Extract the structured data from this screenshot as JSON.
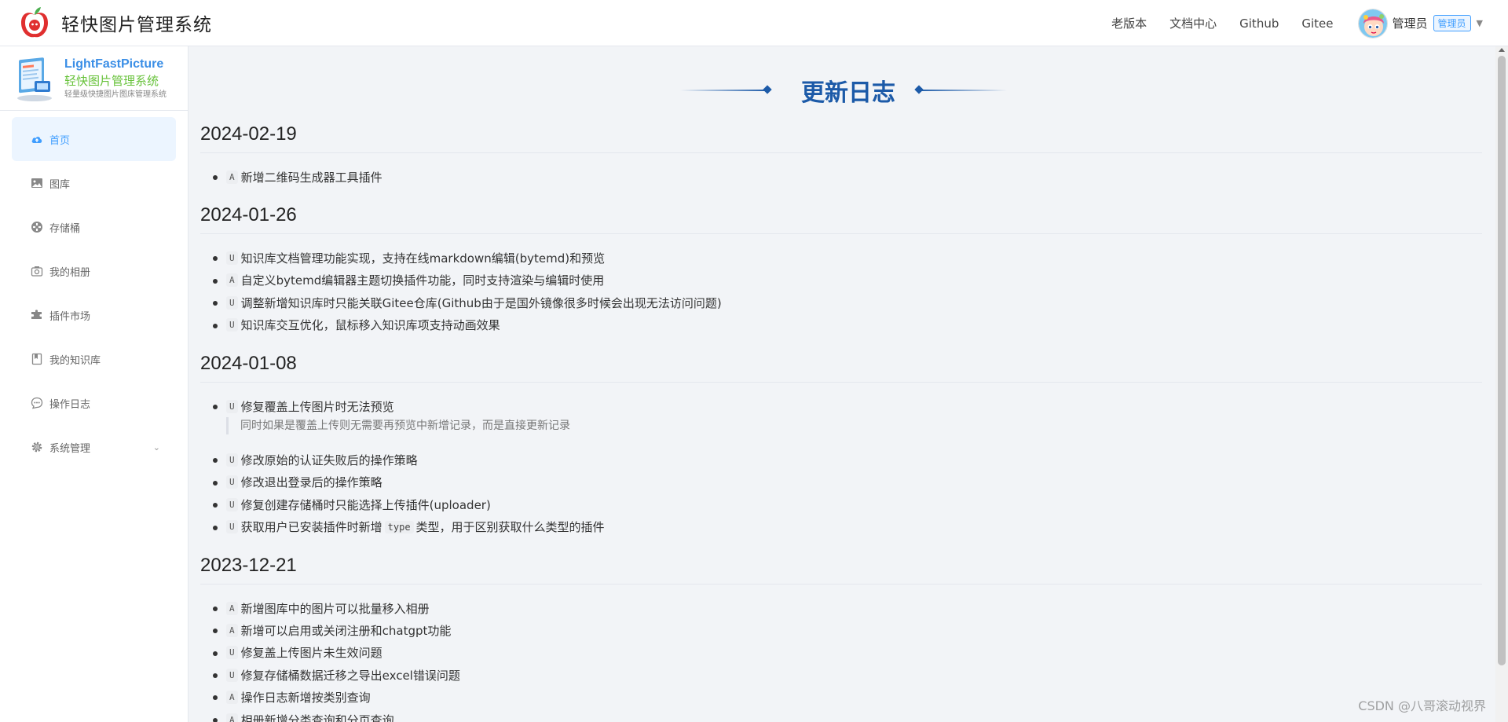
{
  "header": {
    "app_title": "轻快图片管理系统",
    "nav": [
      "老版本",
      "文档中心",
      "Github",
      "Gitee"
    ],
    "user": {
      "name": "管理员",
      "role_badge": "管理员"
    }
  },
  "sidebar": {
    "brand": {
      "name_en": "LightFastPicture",
      "name_cn": "轻快图片管理系统",
      "tagline": "轻量级快捷图片图床管理系统"
    },
    "items": [
      {
        "label": "首页",
        "icon": "cloud-upload-icon",
        "active": true
      },
      {
        "label": "图库",
        "icon": "image-icon",
        "active": false
      },
      {
        "label": "存储桶",
        "icon": "bucket-icon",
        "active": false
      },
      {
        "label": "我的相册",
        "icon": "camera-icon",
        "active": false
      },
      {
        "label": "插件市场",
        "icon": "puzzle-icon",
        "active": false
      },
      {
        "label": "我的知识库",
        "icon": "book-icon",
        "active": false
      },
      {
        "label": "操作日志",
        "icon": "chat-icon",
        "active": false
      },
      {
        "label": "系统管理",
        "icon": "gear-icon",
        "active": false,
        "expandable": true
      }
    ]
  },
  "main": {
    "title": "更新日志",
    "sections": [
      {
        "date": "2024-02-19",
        "entries": [
          {
            "tag": "A",
            "text": "新增二维码生成器工具插件"
          }
        ]
      },
      {
        "date": "2024-01-26",
        "entries": [
          {
            "tag": "U",
            "text": "知识库文档管理功能实现，支持在线markdown编辑(bytemd)和预览"
          },
          {
            "tag": "A",
            "text": "自定义bytemd编辑器主题切换插件功能，同时支持渲染与编辑时使用"
          },
          {
            "tag": "U",
            "text": "调整新增知识库时只能关联Gitee仓库(Github由于是国外镜像很多时候会出现无法访问问题)"
          },
          {
            "tag": "U",
            "text": "知识库交互优化，鼠标移入知识库项支持动画效果"
          }
        ]
      },
      {
        "date": "2024-01-08",
        "entries": [
          {
            "tag": "U",
            "text": "修复覆盖上传图片时无法预览",
            "note": "同时如果是覆盖上传则无需要再预览中新增记录，而是直接更新记录"
          },
          {
            "tag": "U",
            "text": "修改原始的认证失败后的操作策略"
          },
          {
            "tag": "U",
            "text": "修改退出登录后的操作策略"
          },
          {
            "tag": "U",
            "text": "修复创建存储桶时只能选择上传插件(uploader)"
          },
          {
            "tag": "U",
            "text_before": "获取用户已安装插件时新增",
            "code": "type",
            "text_after": "类型，用于区别获取什么类型的插件"
          }
        ]
      },
      {
        "date": "2023-12-21",
        "entries": [
          {
            "tag": "A",
            "text": "新增图库中的图片可以批量移入相册"
          },
          {
            "tag": "A",
            "text": "新增可以启用或关闭注册和chatgpt功能"
          },
          {
            "tag": "U",
            "text": "修复盖上传图片未生效问题"
          },
          {
            "tag": "U",
            "text": "修复存储桶数据迁移之导出excel错误问题"
          },
          {
            "tag": "A",
            "text": "操作日志新增按类别查询"
          },
          {
            "tag": "A",
            "text": "相册新增分类查询和分页查询"
          }
        ]
      }
    ]
  },
  "watermark": "CSDN @八哥滚动视界",
  "colors": {
    "accent": "#409eff",
    "title_blue": "#1c5aa8",
    "brand_green": "#67c23a"
  }
}
